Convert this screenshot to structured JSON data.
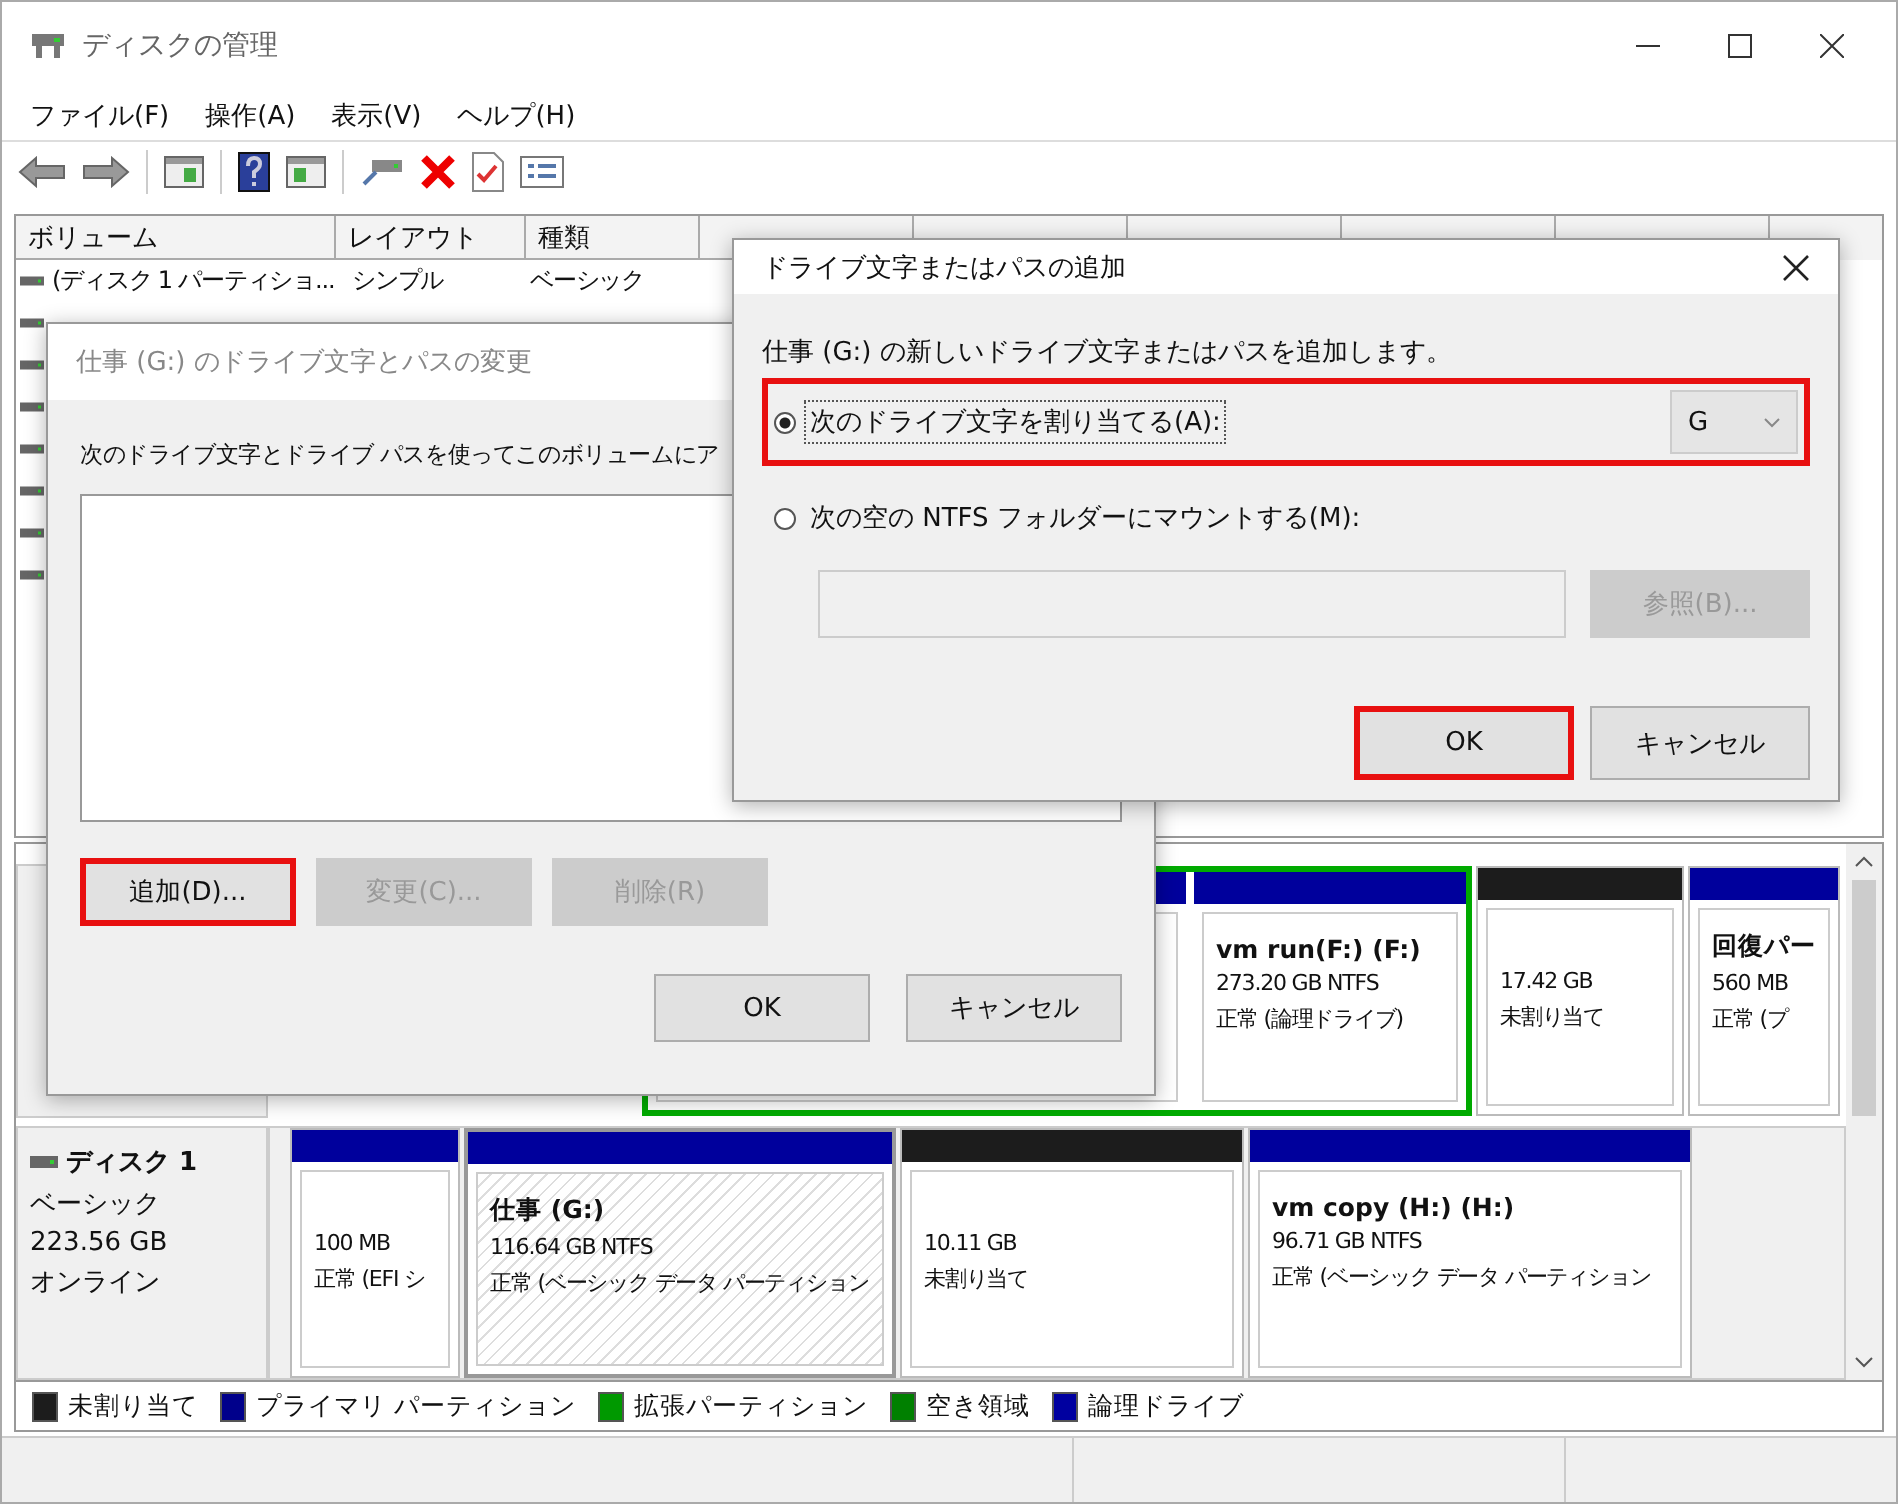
{
  "window": {
    "title": "ディスクの管理"
  },
  "menu": [
    "ファイル(F)",
    "操作(A)",
    "表示(V)",
    "ヘルプ(H)"
  ],
  "volume_list": {
    "columns": [
      "ボリューム",
      "レイアウト",
      "種類"
    ],
    "rows": [
      {
        "volume": "(ディスク 1 パーティショ...",
        "layout": "シンプル",
        "type": "ベーシック"
      }
    ]
  },
  "disks": [
    {
      "partitions": [
        {
          "kind": "extended",
          "selected": false,
          "children": [
            {
              "kind": "logical"
            },
            {
              "kind": "logical",
              "name": "vm run(F:)  (F:)",
              "lines": [
                "273.20 GB NTFS",
                "正常 (論理ドライブ)"
              ]
            }
          ]
        },
        {
          "kind": "unallocated",
          "selected": false,
          "lines": [
            "17.42 GB",
            "未割り当て"
          ]
        },
        {
          "kind": "primary",
          "selected": false,
          "name": "回復パー",
          "lines": [
            "560 MB",
            "正常 (プ"
          ]
        }
      ]
    },
    {
      "name": "ディスク 1",
      "info": [
        "ベーシック",
        "223.56 GB",
        "オンライン"
      ],
      "partitions": [
        {
          "kind": "primary",
          "selected": false,
          "lines": [
            "100 MB",
            "正常 (EFI シ"
          ]
        },
        {
          "kind": "primary",
          "selected": true,
          "name": "仕事 (G:)",
          "lines": [
            "116.64 GB NTFS",
            "正常 (ベーシック データ パーティション"
          ]
        },
        {
          "kind": "unallocated",
          "selected": false,
          "lines": [
            "10.11 GB",
            "未割り当て"
          ]
        },
        {
          "kind": "primary",
          "selected": false,
          "name": "vm copy (H:)  (H:)",
          "lines": [
            "96.71 GB NTFS",
            "正常 (ベーシック データ パーティション"
          ]
        }
      ]
    }
  ],
  "legend": [
    {
      "label": "未割り当て",
      "color": "#1c1c1c"
    },
    {
      "label": "プライマリ パーティション",
      "color": "#00008b"
    },
    {
      "label": "拡張パーティション",
      "color": "#009900"
    },
    {
      "label": "空き領域",
      "color": "#008000"
    },
    {
      "label": "論理ドライブ",
      "color": "#0000a0"
    }
  ],
  "change_dialog": {
    "title": "仕事 (G:) のドライブ文字とパスの変更",
    "instruction": "次のドライブ文字とドライブ パスを使ってこのボリュームにア",
    "buttons": [
      {
        "label": "追加(D)...",
        "disabled": false,
        "highlighted": true
      },
      {
        "label": "変更(C)...",
        "disabled": true,
        "highlighted": false
      },
      {
        "label": "削除(R)",
        "disabled": true,
        "highlighted": false
      }
    ],
    "footer_buttons": [
      "OK",
      "キャンセル"
    ]
  },
  "add_dialog": {
    "title": "ドライブ文字またはパスの追加",
    "prompt": "仕事 (G:) の新しいドライブ文字またはパスを追加します。",
    "options": [
      {
        "label": "次のドライブ文字を割り当てる(A):",
        "selected": true,
        "highlighted": true
      },
      {
        "label": "次の空の NTFS フォルダーにマウントする(M):",
        "selected": false,
        "highlighted": false
      }
    ],
    "drive_letter": "G",
    "browse_button": "参照(B)...",
    "buttons": [
      {
        "label": "OK",
        "highlighted": true
      },
      {
        "label": "キャンセル",
        "highlighted": false
      }
    ]
  }
}
